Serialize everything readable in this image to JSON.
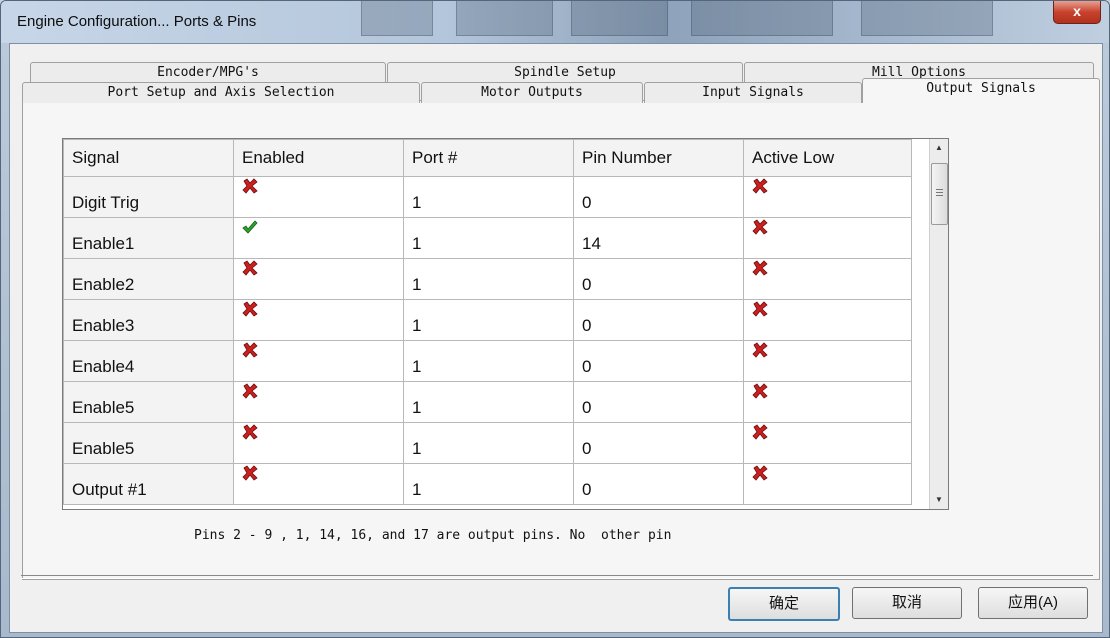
{
  "window": {
    "title": "Engine Configuration... Ports & Pins",
    "close_label": "x"
  },
  "tabs": {
    "row1": [
      "Encoder/MPG's",
      "Spindle Setup",
      "Mill Options"
    ],
    "row2": [
      "Port Setup and Axis Selection",
      "Motor Outputs",
      "Input Signals",
      "Output Signals"
    ],
    "active": "Output Signals"
  },
  "grid": {
    "headers": [
      "Signal",
      "Enabled",
      "Port #",
      "Pin Number",
      "Active Low"
    ],
    "rows": [
      {
        "signal": "Digit Trig",
        "enabled": false,
        "port": "1",
        "pin": "0",
        "active_low": false
      },
      {
        "signal": "Enable1",
        "enabled": true,
        "port": "1",
        "pin": "14",
        "active_low": false
      },
      {
        "signal": "Enable2",
        "enabled": false,
        "port": "1",
        "pin": "0",
        "active_low": false
      },
      {
        "signal": "Enable3",
        "enabled": false,
        "port": "1",
        "pin": "0",
        "active_low": false
      },
      {
        "signal": "Enable4",
        "enabled": false,
        "port": "1",
        "pin": "0",
        "active_low": false
      },
      {
        "signal": "Enable5",
        "enabled": false,
        "port": "1",
        "pin": "0",
        "active_low": false
      },
      {
        "signal": "Enable5",
        "enabled": false,
        "port": "1",
        "pin": "0",
        "active_low": false
      },
      {
        "signal": "Output #1",
        "enabled": false,
        "port": "1",
        "pin": "0",
        "active_low": false
      }
    ]
  },
  "note": "Pins 2 - 9 , 1, 14, 16, and 17 are output pins. No  other pin",
  "buttons": {
    "ok": "确定",
    "cancel": "取消",
    "apply": "应用(A)"
  },
  "colors": {
    "x_mark": "#cc1f1f",
    "check_mark": "#2aa52a",
    "default_button_border": "#3c7fb1"
  }
}
